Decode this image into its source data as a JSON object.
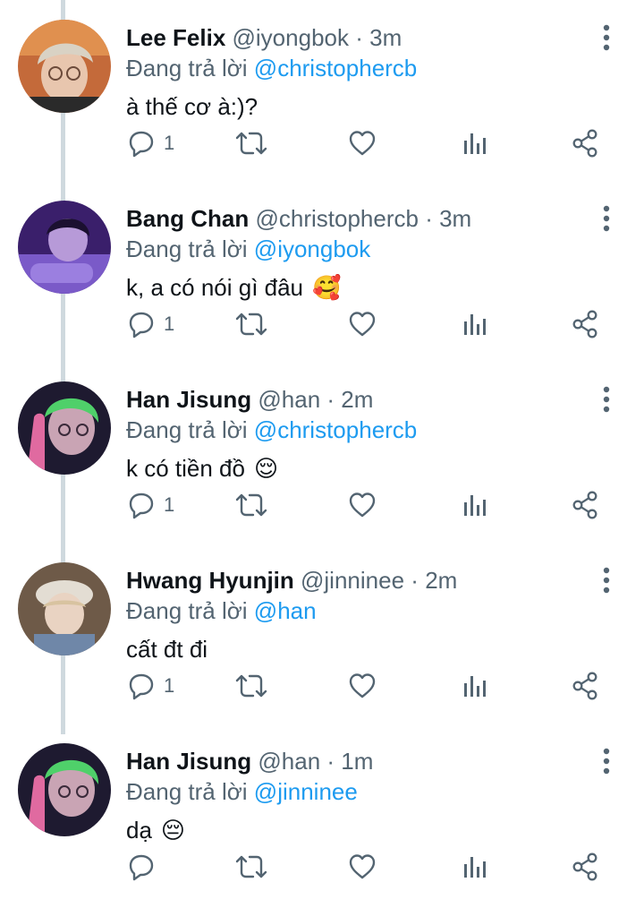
{
  "tweets": [
    {
      "name": "Lee Felix",
      "handle": "@iyongbok",
      "time": "3m",
      "reply_prefix": "Đang trả lời",
      "reply_to": "@christophercb",
      "text": "à thế cơ à:)?",
      "emoji": "",
      "reply_count": "1"
    },
    {
      "name": "Bang Chan",
      "handle": "@christophercb",
      "time": "3m",
      "reply_prefix": "Đang trả lời",
      "reply_to": "@iyongbok",
      "text": "k, a có nói gì đâu",
      "emoji": "🥰",
      "reply_count": "1"
    },
    {
      "name": "Han Jisung",
      "handle": "@han",
      "time": "2m",
      "reply_prefix": "Đang trả lời",
      "reply_to": "@christophercb",
      "text": "k có tiền đồ",
      "emoji": "😌",
      "reply_count": "1"
    },
    {
      "name": "Hwang Hyunjin",
      "handle": "@jinninee",
      "time": "2m",
      "reply_prefix": "Đang trả lời",
      "reply_to": "@han",
      "text": "cất đt đi",
      "emoji": "",
      "reply_count": "1"
    },
    {
      "name": "Han Jisung",
      "handle": "@han",
      "time": "1m",
      "reply_prefix": "Đang trả lời",
      "reply_to": "@jinninee",
      "text": "dạ",
      "emoji": "😔",
      "reply_count": ""
    }
  ],
  "separator": "·",
  "colors": {
    "accent": "#1d9bf0",
    "secondary_text": "#536471",
    "icon": "#536471",
    "thread_line": "#cfd9de"
  },
  "icons": [
    "reply-icon",
    "retweet-icon",
    "like-icon",
    "stats-icon",
    "share-icon",
    "more-icon"
  ]
}
